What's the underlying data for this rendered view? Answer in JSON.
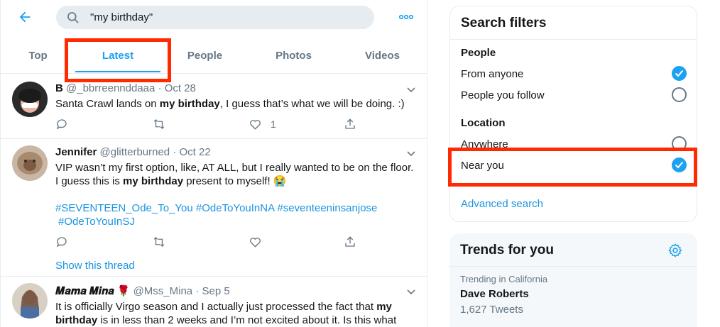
{
  "colors": {
    "accent": "#1da1f2",
    "link": "#1b95e0",
    "highlight": "#ff2a00",
    "muted": "#657786"
  },
  "header": {
    "search_value": "\"my birthday\"",
    "back_icon": "back-arrow-icon",
    "more_icon": "more-horizontal-icon"
  },
  "tabs": [
    {
      "label": "Top",
      "active": false
    },
    {
      "label": "Latest",
      "active": true
    },
    {
      "label": "People",
      "active": false
    },
    {
      "label": "Photos",
      "active": false
    },
    {
      "label": "Videos",
      "active": false
    }
  ],
  "tweets": [
    {
      "name": "B",
      "handle": "@_bbrreennddaaa",
      "sep": "·",
      "date": "Oct 28",
      "text_pre": "Santa Crawl lands on ",
      "text_bold": "my birthday",
      "text_post": ", I guess that’s what we will be doing. :)",
      "like_count": "1"
    },
    {
      "name": "Jennifer",
      "handle": "@glitterburned",
      "sep": "·",
      "date": "Oct 22",
      "text_pre": "VIP wasn’t my first option, like, AT ALL, but I really wanted to be on the floor.  I guess this is ",
      "text_bold": "my birthday",
      "text_post": " present to myself! 😭",
      "hashtags_line1": "#SEVENTEEN_Ode_To_You #OdeToYouInNA #seventeeninsanjose",
      "hashtags_line2": "#OdeToYouInSJ",
      "show_thread": "Show this thread"
    },
    {
      "name": "𝑴𝒂𝒎𝒂 𝑴𝒊𝒏𝒂 🌹",
      "handle": "@Mss_Mina",
      "sep": "·",
      "date": "Sep 5",
      "text_pre": "It is officially Virgo season and I actually just processed the fact that ",
      "text_bold": "my birthday",
      "text_post": " is in less than 2 weeks and I’m not excited about it. Is this what"
    }
  ],
  "filters": {
    "title": "Search filters",
    "people_title": "People",
    "people_options": [
      {
        "label": "From anyone",
        "checked": true
      },
      {
        "label": "People you follow",
        "checked": false
      }
    ],
    "location_title": "Location",
    "location_options": [
      {
        "label": "Anywhere",
        "checked": false
      },
      {
        "label": "Near you",
        "checked": true
      }
    ],
    "advanced_link": "Advanced search"
  },
  "trends": {
    "title": "Trends for you",
    "items": [
      {
        "meta": "Trending in California",
        "name": "Dave Roberts",
        "count": "1,627 Tweets"
      }
    ]
  }
}
